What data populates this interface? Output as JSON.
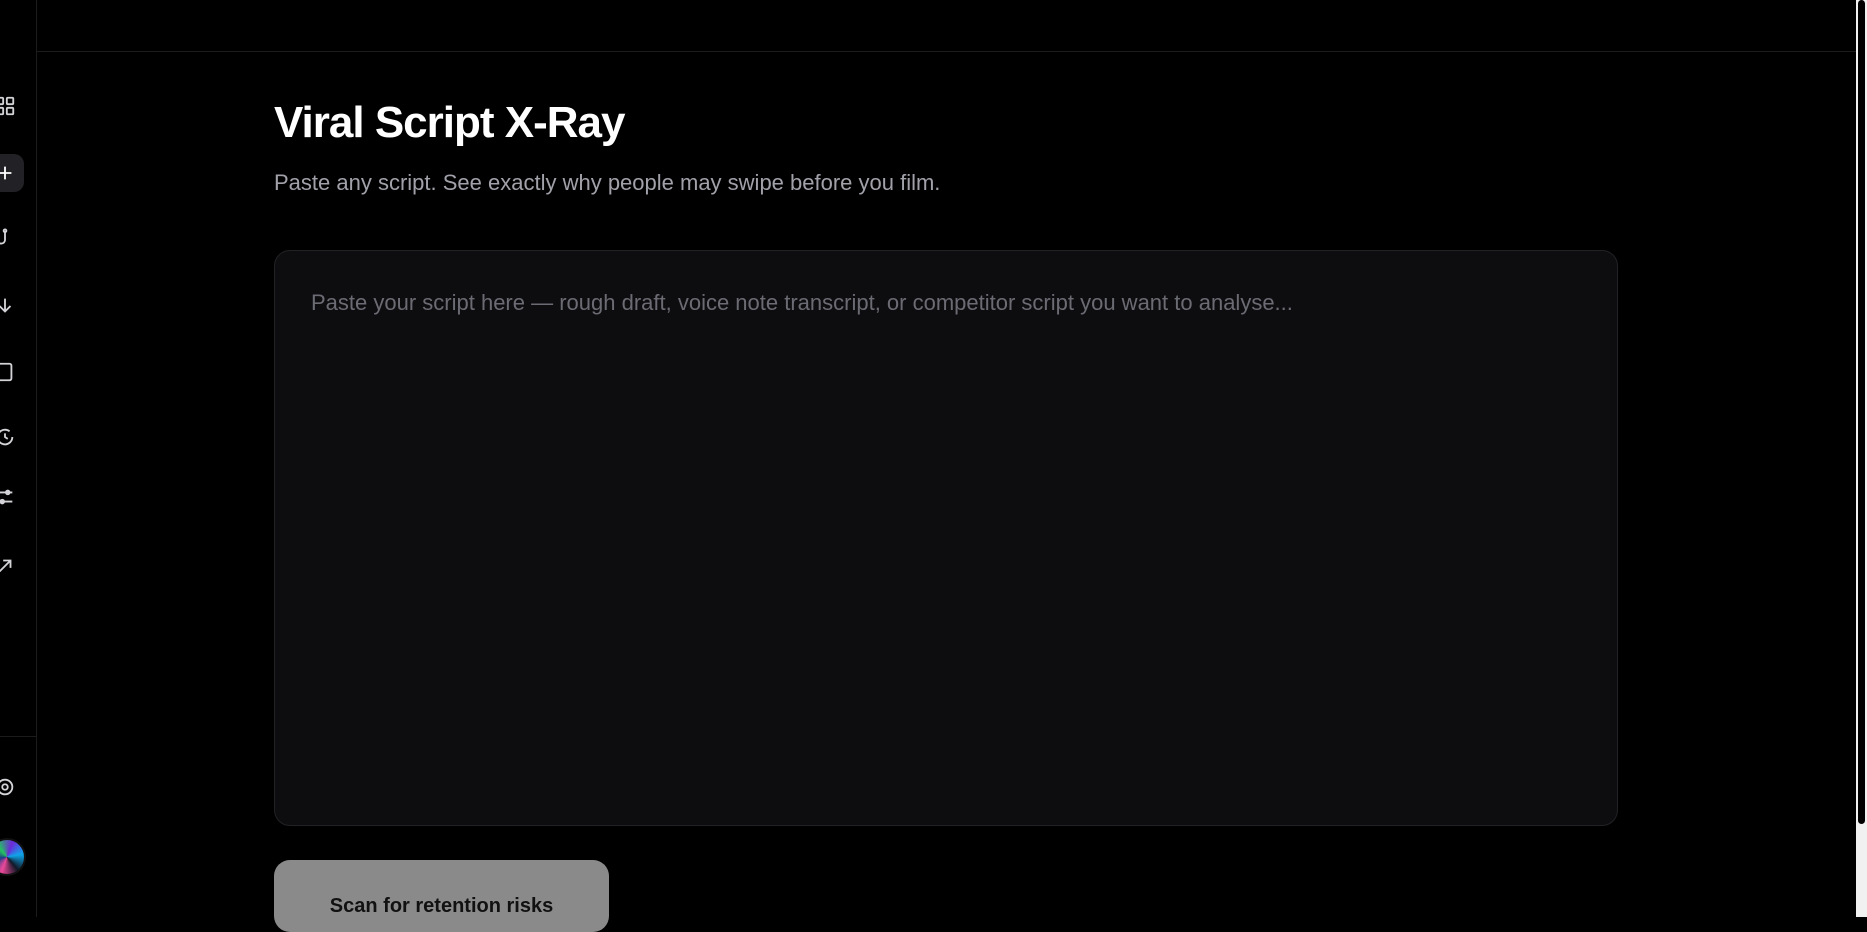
{
  "header": {
    "title": "Viral Script X-Ray",
    "subtitle": "Paste any script. See exactly why people may swipe before you film."
  },
  "editor": {
    "placeholder": "Paste your script here — rough draft, voice note transcript, or competitor script you want to analyse...",
    "value": ""
  },
  "actions": {
    "scan_label": "Scan for retention risks"
  },
  "sidebar": {
    "items": [
      {
        "icon": "dashboard-icon",
        "active": false
      },
      {
        "icon": "add-icon",
        "active": true
      },
      {
        "icon": "hook-icon",
        "active": false
      },
      {
        "icon": "arrow-down-icon",
        "active": false
      },
      {
        "icon": "document-icon",
        "active": false
      },
      {
        "icon": "history-icon",
        "active": false
      },
      {
        "icon": "sliders-icon",
        "active": false
      },
      {
        "icon": "trend-icon",
        "active": false
      }
    ],
    "footer_icon": "settings-icon"
  },
  "colors": {
    "background": "#000000",
    "panel": "#0d0d10",
    "button": "#8a8a8a"
  }
}
